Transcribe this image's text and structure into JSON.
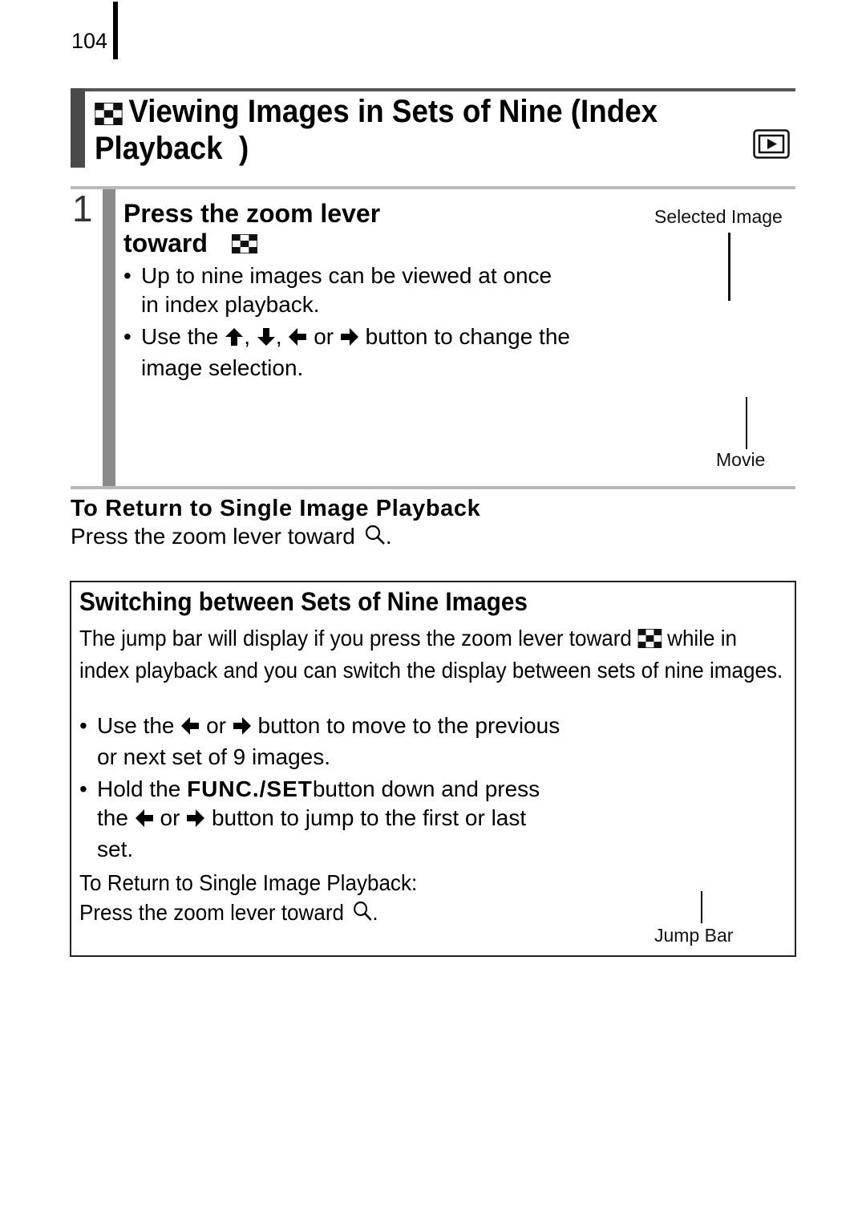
{
  "page": {
    "number": "104"
  },
  "title": {
    "icon": "index-grid-icon",
    "line1": "Viewing Images in Sets of Nine (Index",
    "line2": "Playback  )",
    "mode_icon": "playback-mode-icon"
  },
  "step": {
    "number": "1",
    "heading_line1": "Press the zoom lever",
    "heading_line2": "toward",
    "heading_icon": "index-grid-icon",
    "bullets": [
      {
        "text": "Up to nine images can be viewed at once in index playback."
      },
      {
        "prefix": "Use the",
        "icons": [
          "arrow-up-icon",
          "arrow-down-icon",
          "arrow-left-icon",
          "arrow-right-icon"
        ],
        "sep1": ",",
        "sep2": ",",
        "sep3": "or",
        "suffix": "button to change the image selection."
      }
    ],
    "callouts": {
      "selected_image": "Selected Image",
      "movie": "Movie"
    }
  },
  "return_section": {
    "heading": "To Return to Single Image Playback",
    "text": "Press the zoom lever toward",
    "icon": "magnify-icon",
    "end": "."
  },
  "switch_box": {
    "heading": "Switching between Sets of Nine Images",
    "para_before": "The jump bar will display if you press the zoom lever toward",
    "para_icon": "index-grid-icon",
    "para_after": "while in index playback and you can switch the display between sets of nine images.",
    "bullets": [
      {
        "prefix": "Use the",
        "mid": "or",
        "suffix": "button to move to the previous or next set of 9 images."
      },
      {
        "prefix": "Hold the",
        "bold": "FUNC./SET",
        "suffix1": "button down and press the",
        "mid": "or",
        "suffix2": "button to jump to the first or last set."
      }
    ],
    "return_line1": "To Return to Single Image Playback:",
    "return_line2": "Press the zoom lever toward",
    "return_end": ".",
    "callout_jump_bar": "Jump Bar"
  }
}
